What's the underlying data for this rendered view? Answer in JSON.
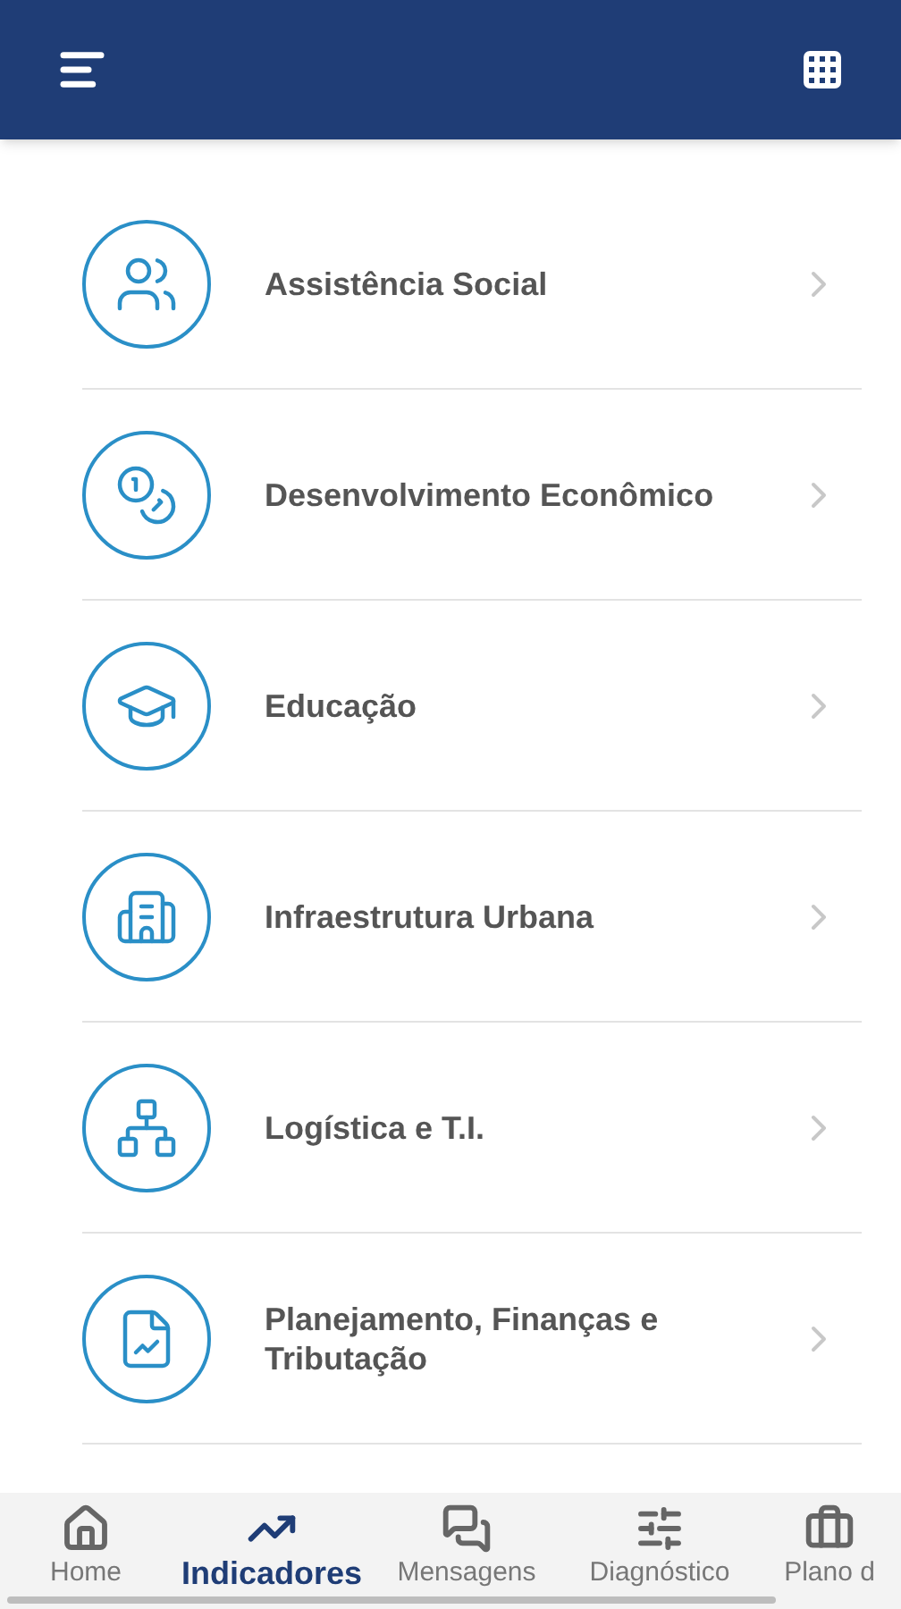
{
  "categories": [
    {
      "label": "Assistência Social"
    },
    {
      "label": "Desenvolvimento Econômico"
    },
    {
      "label": "Educação"
    },
    {
      "label": "Infraestrutura Urbana"
    },
    {
      "label": "Logística e T.I."
    },
    {
      "label": "Planejamento, Finanças e Tributação"
    }
  ],
  "bottom_nav": [
    {
      "label": "Home",
      "selected": false
    },
    {
      "label": "Indicadores",
      "selected": true
    },
    {
      "label": "Mensagens",
      "selected": false
    },
    {
      "label": "Diagnóstico",
      "selected": false
    },
    {
      "label": "Plano d",
      "selected": false
    }
  ]
}
